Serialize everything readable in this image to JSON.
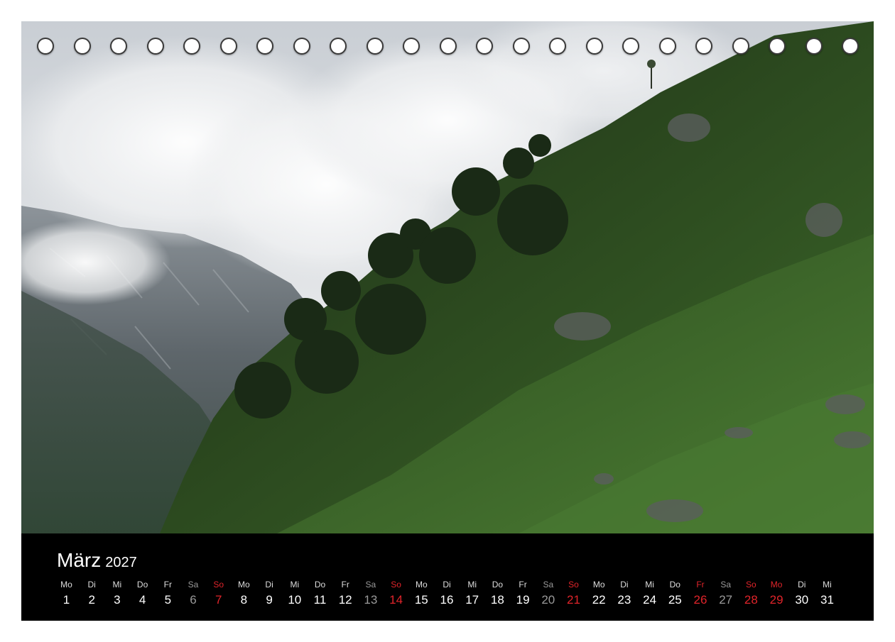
{
  "calendar": {
    "month": "März",
    "year": "2027",
    "days": [
      {
        "wd": "Mo",
        "d": "1",
        "t": "n"
      },
      {
        "wd": "Di",
        "d": "2",
        "t": "n"
      },
      {
        "wd": "Mi",
        "d": "3",
        "t": "n"
      },
      {
        "wd": "Do",
        "d": "4",
        "t": "n"
      },
      {
        "wd": "Fr",
        "d": "5",
        "t": "n"
      },
      {
        "wd": "Sa",
        "d": "6",
        "t": "s"
      },
      {
        "wd": "So",
        "d": "7",
        "t": "h"
      },
      {
        "wd": "Mo",
        "d": "8",
        "t": "n"
      },
      {
        "wd": "Di",
        "d": "9",
        "t": "n"
      },
      {
        "wd": "Mi",
        "d": "10",
        "t": "n"
      },
      {
        "wd": "Do",
        "d": "11",
        "t": "n"
      },
      {
        "wd": "Fr",
        "d": "12",
        "t": "n"
      },
      {
        "wd": "Sa",
        "d": "13",
        "t": "s"
      },
      {
        "wd": "So",
        "d": "14",
        "t": "h"
      },
      {
        "wd": "Mo",
        "d": "15",
        "t": "n"
      },
      {
        "wd": "Di",
        "d": "16",
        "t": "n"
      },
      {
        "wd": "Mi",
        "d": "17",
        "t": "n"
      },
      {
        "wd": "Do",
        "d": "18",
        "t": "n"
      },
      {
        "wd": "Fr",
        "d": "19",
        "t": "n"
      },
      {
        "wd": "Sa",
        "d": "20",
        "t": "s"
      },
      {
        "wd": "So",
        "d": "21",
        "t": "h"
      },
      {
        "wd": "Mo",
        "d": "22",
        "t": "n"
      },
      {
        "wd": "Di",
        "d": "23",
        "t": "n"
      },
      {
        "wd": "Mi",
        "d": "24",
        "t": "n"
      },
      {
        "wd": "Do",
        "d": "25",
        "t": "n"
      },
      {
        "wd": "Fr",
        "d": "26",
        "t": "h"
      },
      {
        "wd": "Sa",
        "d": "27",
        "t": "s"
      },
      {
        "wd": "So",
        "d": "28",
        "t": "h"
      },
      {
        "wd": "Mo",
        "d": "29",
        "t": "h"
      },
      {
        "wd": "Di",
        "d": "30",
        "t": "n"
      },
      {
        "wd": "Mi",
        "d": "31",
        "t": "n"
      }
    ]
  },
  "colors": {
    "background": "#000000",
    "text": "#ffffff",
    "saturday": "#9a9a9a",
    "holiday": "#e0242a"
  },
  "binding_holes": 23
}
